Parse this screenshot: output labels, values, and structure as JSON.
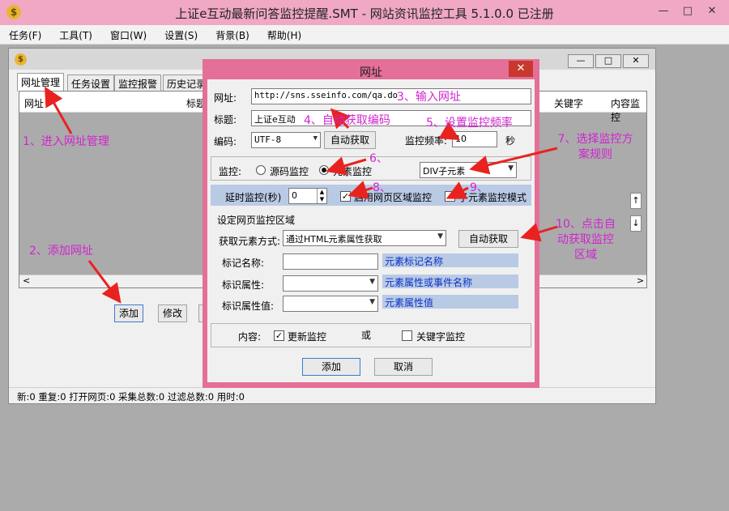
{
  "app": {
    "title": "上证e互动最新问答监控提醒.SMT  - 网站资讯监控工具 5.1.0.0  已注册",
    "logo": "$"
  },
  "window_buttons": {
    "minimize": "—",
    "maximize": "□",
    "close": "✕"
  },
  "menu": [
    "任务(F)",
    "工具(T)",
    "窗口(W)",
    "设置(S)",
    "背景(B)",
    "帮助(H)"
  ],
  "child": {
    "tabs": [
      "网址管理",
      "任务设置",
      "监控报警",
      "历史记录"
    ],
    "columns": [
      "网址",
      "标题",
      "关键字",
      "内容监控"
    ],
    "buttons": {
      "add": "添加",
      "modify": "修改"
    },
    "status": "新:0  重复:0  打开网页:0  采集总数:0  过滤总数:0  用时:0"
  },
  "dialog": {
    "title": "网址",
    "url_label": "网址:",
    "url_value": "http://sns.sseinfo.com/qa.do",
    "title_label": "标题:",
    "title_value": "上证e互动",
    "encoding_label": "编码:",
    "encoding_value": "UTF-8",
    "auto_get_label": "自动获取",
    "freq_label": "监控频率:",
    "freq_value": "10",
    "freq_unit": "秒",
    "monitor_label": "监控:",
    "radio_source": "源码监控",
    "radio_element": "元素监控",
    "scheme_value": "DIV子元素",
    "delay_label": "延时监控(秒)",
    "delay_value": "0",
    "enable_region": "启用网页区域监控",
    "child_mode": "子元素监控模式",
    "region_title": "设定网页监控区域",
    "get_method_label": "获取元素方式:",
    "get_method_value": "通过HTML元素属性获取",
    "auto_get_btn": "自动获取",
    "mark_name_label": "标记名称:",
    "mark_name_hint": "元素标记名称",
    "mark_attr_label": "标识属性:",
    "mark_attr_hint": "元素属性或事件名称",
    "mark_val_label": "标识属性值:",
    "mark_val_hint": "元素属性值",
    "content_label": "内容:",
    "update_monitor": "更新监控",
    "or": "或",
    "keyword_monitor": "关键字监控",
    "ok": "添加",
    "cancel": "取消"
  },
  "annotations": {
    "a1": "1、进入网址管理",
    "a2": "2、添加网址",
    "a3": "3、输入网址",
    "a4": "4、自动获取编码",
    "a5": "5、设置监控频率",
    "a6": "6、",
    "a7": "7、选择监控方案规则",
    "a8": "8、",
    "a9": "9、",
    "a10": "10、点击自动获取监控区域"
  },
  "colors": {
    "annotation": "#d224d0",
    "arrow": "#e8231f",
    "dialog_border": "#e46f98",
    "hint_bg": "#b9cae4"
  }
}
